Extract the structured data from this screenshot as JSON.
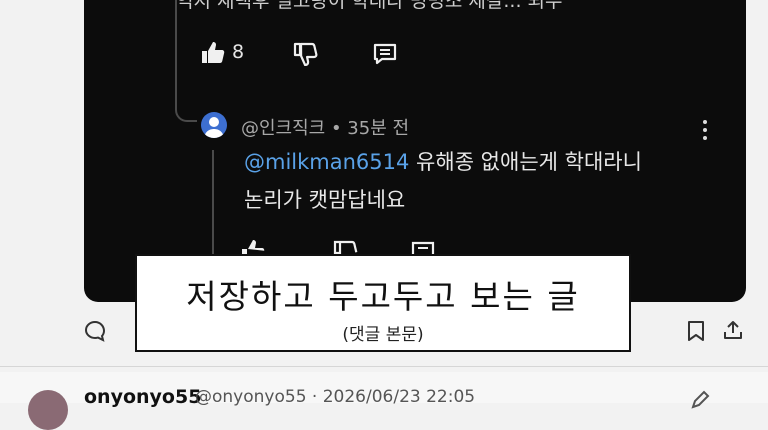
{
  "comment_card": {
    "truncated_text": "억지 재택후 밀고랑이 학대라 명명조 제갈... 되우",
    "like_count": "8"
  },
  "reply": {
    "author_meta": "@인크직크 • 35분 전",
    "mention": "@milkman6514",
    "text_line1": " 유해종 없애는게 학대라니",
    "text_line2": "논리가 캣맘답네요"
  },
  "caption": {
    "title": "저장하고 두고두고 보는 글",
    "subtitle": "(댓글 본문)"
  },
  "next_post": {
    "author": "onyonyo55",
    "meta": "@onyonyo55 · 2026/06/23 22:05"
  },
  "icons": [
    "thumbs-up-icon",
    "thumbs-down-icon",
    "reply-icon",
    "avatar-icon",
    "more-icon",
    "comment-icon",
    "bookmark-icon",
    "share-icon",
    "edit-icon"
  ],
  "colors": {
    "card_bg": "#0c0c0c",
    "mention": "#5aa2e8",
    "page_bg": "#f2f2f2"
  }
}
